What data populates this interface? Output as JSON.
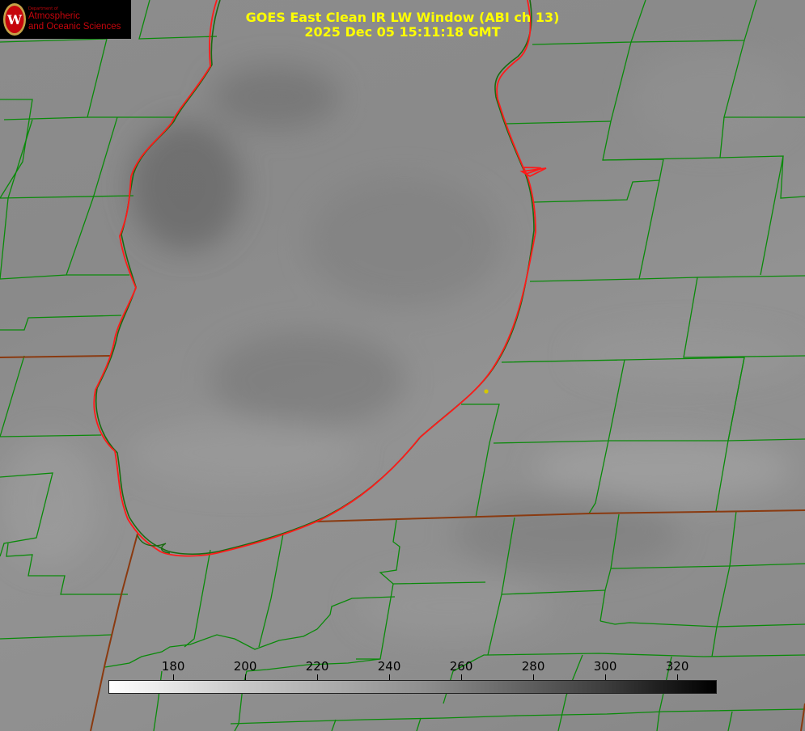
{
  "title": {
    "line1": "GOES East Clean IR LW Window (ABI ch 13)",
    "line2": "2025 Dec 05 15:11:18 GMT"
  },
  "logo": {
    "department": "Department of",
    "name_line1": "Atmospheric",
    "name_line2": "and Oceanic Sciences",
    "seal_letter": "W",
    "color": "#c5050c"
  },
  "colorbar": {
    "ticks": [
      "180",
      "200",
      "220",
      "240",
      "260",
      "280",
      "300",
      "320"
    ],
    "scale_min": 162,
    "scale_max": 331,
    "gradient": "white-to-black"
  },
  "colors": {
    "county_lines": "#0a8a0a",
    "lake_outline": "#ff1a1a",
    "state_lines": "#8a3a10",
    "marker": "#d4c800",
    "title_text": "#ffff00"
  }
}
